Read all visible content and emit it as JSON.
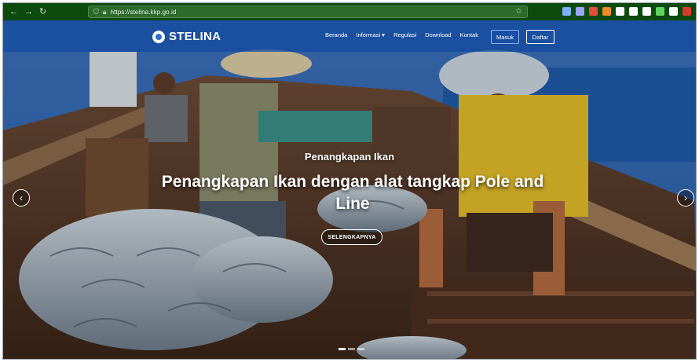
{
  "browser": {
    "url": "https://stelina.kkp.go.id",
    "back_glyph": "←",
    "forward_glyph": "→",
    "reload_glyph": "↻",
    "star_glyph": "☆",
    "extension_colors": [
      "#7fb0ff",
      "#9aa7ff",
      "#e44d3a",
      "#f08a24",
      "#ffffff",
      "#ffffff",
      "#ffffff",
      "#5fd35f",
      "#ffffff",
      "#d93a2f",
      "#ffffff"
    ]
  },
  "site": {
    "brand": "STELINA",
    "nav": [
      "Beranda",
      "Informasi ▾",
      "Regulasi",
      "Download",
      "Kontak"
    ],
    "login_label": "Masuk",
    "register_label": "Daftar"
  },
  "hero": {
    "subtitle": "Penangkapan Ikan",
    "title": "Penangkapan Ikan dengan alat tangkap Pole and Line",
    "cta_label": "SELENGKAPNYA",
    "prev_glyph": "‹",
    "next_glyph": "›",
    "slide_count": 3,
    "active_slide": 1
  },
  "colors": {
    "browser_bar": "#0d4a0e",
    "navbar": "#1248a0",
    "sea": "#1f5aa8"
  }
}
